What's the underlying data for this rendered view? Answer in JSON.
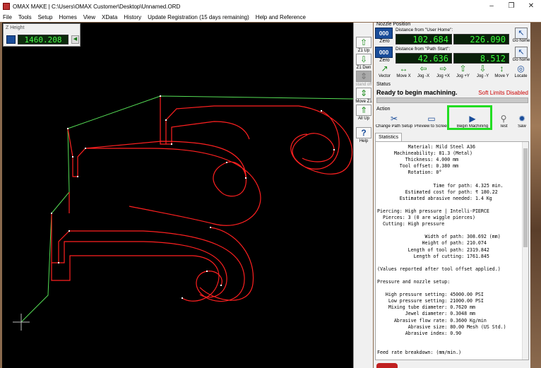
{
  "window": {
    "title": "OMAX MAKE | C:\\Users\\OMAX Customer\\Desktop\\Unnamed.ORD",
    "controls": [
      "–",
      "❐",
      "✕"
    ]
  },
  "menu": [
    "File",
    "Tools",
    "Setup",
    "Homes",
    "View",
    "XData",
    "History",
    "Update Registration (15 days remaining)",
    "Help and Reference"
  ],
  "zheight": {
    "title": "Z Height",
    "value": "1460.208"
  },
  "ztoolbar": [
    {
      "label": "Z1 Up",
      "icon": "up-arrow-icon",
      "glyph": "⇧",
      "disabled": false
    },
    {
      "label": "Z1 Dwn",
      "icon": "down-arrow-icon",
      "glyph": "⇩",
      "disabled": false
    },
    {
      "label": "stand off",
      "icon": "standoff-icon",
      "glyph": "⇕",
      "disabled": true
    },
    {
      "label": "Move Z1",
      "icon": "move-z-icon",
      "glyph": "⇕",
      "disabled": false
    },
    {
      "label": "All Up",
      "icon": "all-up-icon",
      "glyph": "⇑",
      "disabled": false
    },
    {
      "label": "Help",
      "icon": "help-icon",
      "glyph": "?",
      "disabled": false
    }
  ],
  "nozzle": {
    "section_label": "Nozzle Position",
    "rows": [
      {
        "zero_icon": "000",
        "zero_label": "Zero",
        "desc": "Distance from \"User Home\":",
        "x": "102.684",
        "y": "226.090",
        "home_label": "Go home"
      },
      {
        "zero_icon": "000",
        "zero_label": "Zero",
        "desc": "Distance from \"Path Start\":",
        "x": "42.636",
        "y": "8.512",
        "home_label": "Go home"
      }
    ]
  },
  "jog": [
    {
      "label": "Vector",
      "glyph": "↗"
    },
    {
      "label": "Move X",
      "glyph": "↔"
    },
    {
      "label": "Jog -X",
      "glyph": "⇦"
    },
    {
      "label": "Jog +X",
      "glyph": "⇨"
    },
    {
      "label": "Jog +Y",
      "glyph": "⇧"
    },
    {
      "label": "Jog -Y",
      "glyph": "⇩"
    },
    {
      "label": "Move Y",
      "glyph": "↕"
    },
    {
      "label": "Locate",
      "glyph": "◎"
    }
  ],
  "status": {
    "section_label": "Status",
    "message": "Ready to begin machining.",
    "soft_limits": "Soft Limits Disabled",
    "progress": 0
  },
  "actions": {
    "section_label": "Action",
    "items": [
      {
        "label": "Change Path Setup",
        "glyph": "✂"
      },
      {
        "label": "Preview to Screen",
        "glyph": "▭"
      },
      {
        "label": "Begin Machining",
        "glyph": "▶"
      },
      {
        "label": "Test",
        "glyph": "⚲"
      },
      {
        "label": "Saw",
        "glyph": "✹"
      }
    ]
  },
  "statistics": {
    "tab_label": "Statistics",
    "lines": [
      "           Material: Mild Steel A36",
      "      Machineability: 81.3 (Metal)",
      "          Thickness: 4.000 mm",
      "        Tool offset: 0.380 mm",
      "           Rotation: 0°",
      "",
      "                    Time for path: 4.325 min.",
      "          Estimated cost for path: ₹ 180.22",
      "        Estimated abrasive needed: 1.4 Kg",
      "",
      "Piercing: High pressure | Intelli-PIERCE",
      "  Pierces: 3 (0 are wiggle pierces)",
      "  Cutting: High pressure",
      "",
      "                 Width of path: 308.692 (mm)",
      "                Height of path: 210.074",
      "           Length of tool path: 2319.842",
      "             Length of cutting: 1761.845",
      "",
      "(Values reported after tool offset applied.)",
      "",
      "Pressure and nozzle setup:",
      "",
      "   High pressure setting: 45000.00 PSI",
      "    Low pressure setting: 21000.00 PSI",
      "    Mixing tube diameter: 0.7620 mm",
      "          Jewel diameter: 0.3048 mm",
      "      Abrasive flow rate: 0.3600 Kg/min",
      "           Abrasive size: 80.00 Mesh (US Std.)",
      "          Abrasive index: 0.90",
      "",
      "",
      "Feed rate breakdown: (mm/min.)"
    ]
  },
  "colors": {
    "cut_path": "#ff2020",
    "traverse_path": "#55dd55",
    "highlight": "#22dd22",
    "readout_text": "#3bff3b"
  }
}
